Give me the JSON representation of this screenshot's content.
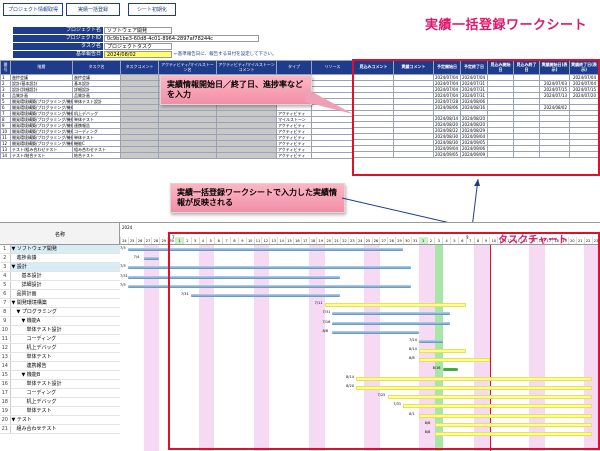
{
  "toolbar": {
    "buttons": [
      "プロジェクト情報取得",
      "実績一括登録",
      "シート初期化"
    ]
  },
  "sheet_title": "実績一括登録ワークシート",
  "project_info": {
    "labels": [
      "プロジェクト名",
      "プロジェクトID",
      "タスク名",
      "基準報告日"
    ],
    "values": [
      "ソフトウェア開発",
      "0c9b1be3-60d8-4c01-8964-2897af78244c",
      "プロジェクトタスク",
      "2024/08/02"
    ],
    "note": "←基準報告日に、報告する日付を設定して下さい。"
  },
  "task_table": {
    "headers": [
      "番号",
      "階層",
      "タスク名",
      "タスクコメント",
      "アクティビティ/マイルストーン名",
      "アクティビティ/マイルストーンコメント",
      "タイプ",
      "リソース"
    ],
    "rows": [
      [
        "1",
        "進捗会議",
        "進捗会議",
        "",
        "",
        "",
        "",
        ""
      ],
      [
        "2",
        "設計/基本設計",
        "基本設計",
        "",
        "",
        "",
        "",
        ""
      ],
      [
        "3",
        "設計/詳細設計",
        "詳細設計",
        "",
        "",
        "",
        "",
        ""
      ],
      [
        "4",
        "品質計画",
        "品質計画",
        "",
        "",
        "",
        "",
        ""
      ],
      [
        "5",
        "開発環境構築/プログラミング/機能A/単体テスト設計",
        "単体テスト設計",
        "",
        "",
        "",
        "",
        ""
      ],
      [
        "6",
        "開発環境構築/プログラミング/機能A/コーディング",
        "",
        "",
        "",
        "",
        "",
        ""
      ],
      [
        "7",
        "開発環境構築/プログラミング/機能",
        "机上デバッグ",
        "",
        "",
        "",
        "アクティビティ",
        ""
      ],
      [
        "8",
        "開発環境構築/プログラミング/機能",
        "単体テスト",
        "",
        "",
        "",
        "マイルストーン",
        ""
      ],
      [
        "9",
        "開発環境構築/プログラミング/機能",
        "連携報告",
        "",
        "",
        "",
        "アクティビティ",
        ""
      ],
      [
        "10",
        "開発環境構築/プログラミング/機能",
        "コーディング",
        "",
        "",
        "",
        "アクティビティ",
        ""
      ],
      [
        "11",
        "開発環境構築/プログラミング/機能",
        "単体テスト",
        "",
        "",
        "",
        "アクティビティ",
        ""
      ],
      [
        "12",
        "開発環境構築/プログラミング/機能",
        "機能C",
        "",
        "",
        "",
        "アクティビティ",
        ""
      ],
      [
        "13",
        "テスト/組み合わせテスト",
        "組み合わせテスト",
        "",
        "",
        "",
        "アクティビティ",
        ""
      ],
      [
        "14",
        "テスト/結合テスト",
        "結合テスト",
        "",
        "",
        "",
        "アクティビティ",
        ""
      ]
    ]
  },
  "result_table": {
    "headers": [
      "見込みコメント",
      "実績コメント",
      "予定開始日",
      "予定終了日",
      "見込み開始日",
      "見込み終了日",
      "実績開始日(表示)",
      "実績終了日(表示)"
    ],
    "rows": [
      [
        "",
        "",
        "2024/07/04",
        "2024/07/04",
        "",
        "",
        "",
        "2024/07/04"
      ],
      [
        "",
        "",
        "2024/07/04",
        "2024/07/31",
        "",
        "",
        "2024/07/03",
        "2024/07/04"
      ],
      [
        "",
        "",
        "2024/07/04",
        "2024/07/31",
        "",
        "",
        "2024/07/15",
        "2024/07/15"
      ],
      [
        "",
        "",
        "2024/07/04",
        "2024/07/31",
        "",
        "",
        "2024/07/13",
        "2024/07/20"
      ],
      [
        "",
        "",
        "2024/07/28",
        "2024/08/06",
        "",
        "",
        "",
        ""
      ],
      [
        "",
        "",
        "2024/08/06",
        "2024/08/16",
        "",
        "",
        "2024/08/02",
        ""
      ],
      [
        "",
        "",
        "",
        "",
        "",
        "",
        "",
        ""
      ],
      [
        "",
        "",
        "2024/08/14",
        "2024/08/20",
        "",
        "",
        "",
        ""
      ],
      [
        "",
        "",
        "2024/08/20",
        "2024/08/20",
        "",
        "",
        "",
        ""
      ],
      [
        "",
        "",
        "2024/08/22",
        "2024/08/29",
        "",
        "",
        "",
        ""
      ],
      [
        "",
        "",
        "2024/08/30",
        "2024/09/04",
        "",
        "",
        "",
        ""
      ],
      [
        "",
        "",
        "2024/08/30",
        "2024/09/05",
        "",
        "",
        "",
        ""
      ],
      [
        "",
        "",
        "2024/09/04",
        "2024/09/06",
        "",
        "",
        "",
        ""
      ],
      [
        "",
        "",
        "2024/09/05",
        "2024/09/09",
        "",
        "",
        "",
        ""
      ]
    ]
  },
  "callouts": {
    "input": "実績情報開始日／終了日、進捗率などを入力",
    "reflect": "実績一括登録ワークシートで入力した実績情報が反映される"
  },
  "gantt": {
    "title": "タスクチャート",
    "name_header": "名称",
    "year": "2024",
    "month_marks": [
      "7",
      "8"
    ],
    "days": [
      "24",
      "25",
      "26",
      "27",
      "28",
      "29",
      "30",
      "1",
      "2",
      "3",
      "4",
      "5",
      "6",
      "7",
      "8",
      "9",
      "10",
      "11",
      "12",
      "13",
      "14",
      "15",
      "16",
      "17",
      "18",
      "19",
      "20",
      "21",
      "22",
      "23",
      "24",
      "25",
      "26",
      "27",
      "28",
      "29",
      "30",
      "31",
      "1",
      "2",
      "3",
      "4",
      "5",
      "6",
      "7",
      "8",
      "9",
      "10",
      "11",
      "12",
      "13",
      "14",
      "15",
      "16",
      "17",
      "18",
      "19",
      "20",
      "21",
      "22",
      "23"
    ],
    "rows": [
      [
        "1",
        "▼ ソフトウェア開発"
      ],
      [
        "2",
        "　進捗会議"
      ],
      [
        "3",
        "▼ 設計"
      ],
      [
        "4",
        "　　基本設計"
      ],
      [
        "5",
        "　　詳細設計"
      ],
      [
        "6",
        "　品質計画"
      ],
      [
        "7",
        "▼ 開発環境構築"
      ],
      [
        "8",
        "　▼ プログラミング"
      ],
      [
        "9",
        "　　▼ 機能A"
      ],
      [
        "10",
        "　　　単体テスト設計"
      ],
      [
        "11",
        "　　　コーディング"
      ],
      [
        "12",
        "　　　机上デバッグ"
      ],
      [
        "13",
        "　　　単体テスト"
      ],
      [
        "14",
        "　　　連携報告"
      ],
      [
        "15",
        "　　▼ 機能B"
      ],
      [
        "16",
        "　　　単体テスト設計"
      ],
      [
        "17",
        "　　　コーディング"
      ],
      [
        "18",
        "　　　机上デバッグ"
      ],
      [
        "19",
        "　　　単体テスト"
      ],
      [
        "20",
        "▼ テスト"
      ],
      [
        "21",
        "　組み合わせテスト"
      ]
    ],
    "bar_labels": [
      "7/3",
      "7/4",
      "7/3",
      "7/31",
      "7/3",
      "7/31",
      "7/11",
      "7/31",
      "7/16",
      "8/6",
      "7/24",
      "8/14",
      "8/8",
      "8/16",
      "8/14",
      "8/20",
      "7/25",
      "7/31",
      "8/1",
      "8/8",
      "8/8"
    ]
  }
}
